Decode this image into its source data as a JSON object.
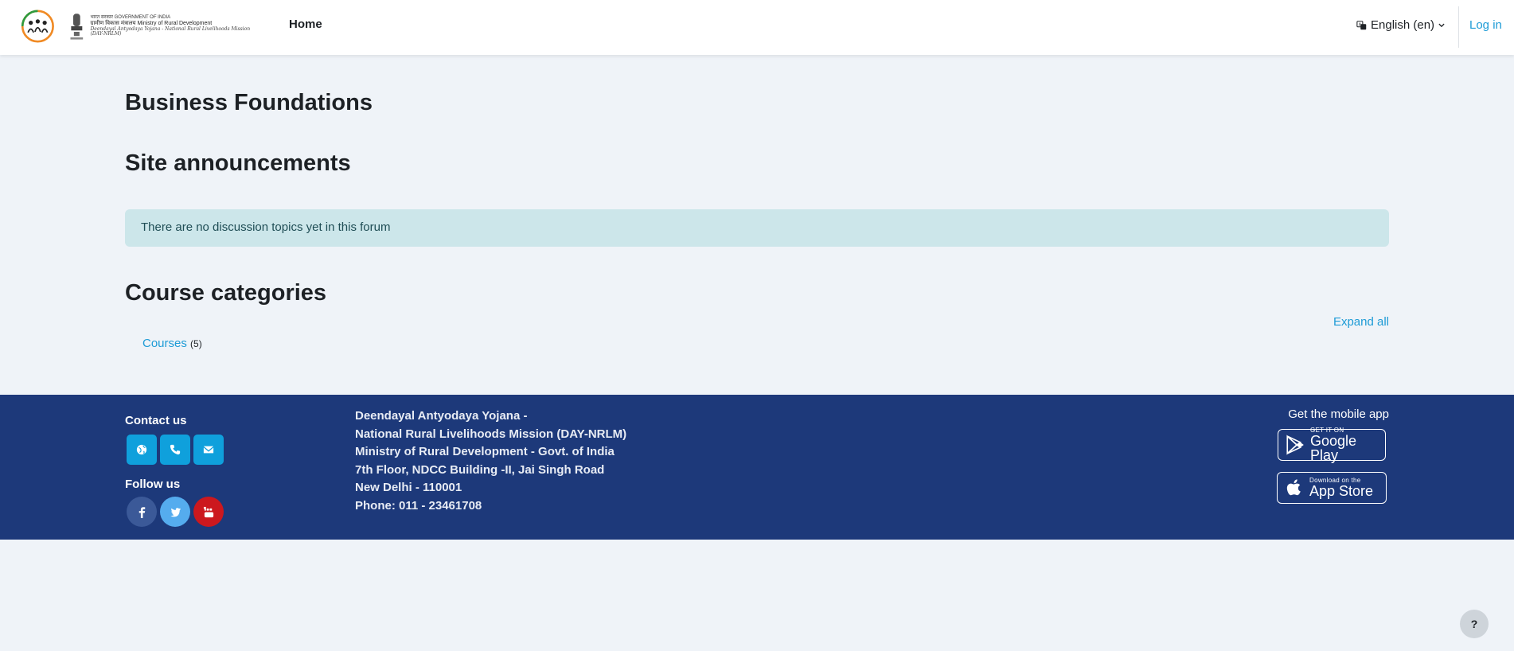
{
  "header": {
    "logo_line1": "भारत सरकार  GOVERNMENT OF INDIA",
    "logo_line2": "ग्रामीण विकास मंत्रालय  Ministry of Rural Development",
    "logo_line3": "Deendayal Antyodaya Yojana - National Rural Livelihoods Mission (DAY-NRLM)",
    "home_label": "Home",
    "language_label": "English (en)",
    "login_label": "Log in"
  },
  "main": {
    "site_title": "Business Foundations",
    "announcements_heading": "Site announcements",
    "announcement_alert": "There are no discussion topics yet in this forum",
    "categories_heading": "Course categories",
    "expand_all_label": "Expand all",
    "categories": [
      {
        "name": "Courses",
        "count": "(5)"
      }
    ]
  },
  "footer": {
    "contact_title": "Contact us",
    "follow_title": "Follow us",
    "address_lines": [
      "Deendayal Antyodaya Yojana -",
      "National Rural Livelihoods Mission (DAY-NRLM)",
      "Ministry of Rural Development - Govt. of India",
      "7th Floor, NDCC Building -II, Jai Singh Road",
      "New Delhi - 110001",
      "Phone: 011 - 23461708"
    ],
    "app_title": "Get the mobile app",
    "google_play_small": "GET IT ON",
    "google_play_big": "Google Play",
    "app_store_small": "Download on the",
    "app_store_big": "App Store"
  },
  "help_label": "?",
  "colors": {
    "accent": "#1d9bd6",
    "footer_bg": "#1d397a",
    "page_bg": "#eff3f8",
    "alert_bg": "#cce6ea",
    "facebook": "#3b5998",
    "twitter": "#55acee",
    "youtube": "#cc181e"
  }
}
